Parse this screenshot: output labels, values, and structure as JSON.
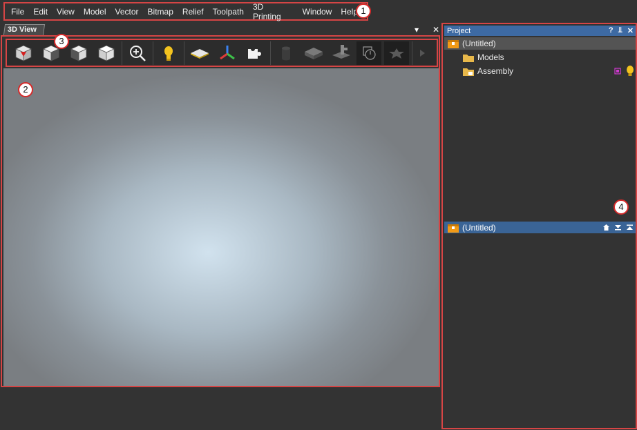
{
  "menu": [
    "File",
    "Edit",
    "View",
    "Model",
    "Vector",
    "Bitmap",
    "Relief",
    "Toolpath",
    "3D Printing",
    "Window",
    "Help"
  ],
  "callouts": [
    "1",
    "2",
    "3",
    "4"
  ],
  "view": {
    "tab_label": "3D View",
    "dropdown_glyph": "▾",
    "close_glyph": "✕"
  },
  "toolbar_icons": [
    "iso-view-cube-icon",
    "front-view-cube-icon",
    "side-view-cube-icon",
    "top-view-cube-icon",
    "zoom-icon",
    "light-bulb-icon",
    "plane-icon",
    "axes-icon",
    "puzzle-icon",
    "cylinder-icon",
    "block-icon",
    "tool-icon",
    "clock-icon",
    "star-icon",
    "more-arrow-icon"
  ],
  "project": {
    "title": "Project",
    "header_controls": [
      "?",
      "⫫",
      "✕"
    ],
    "root": "(Untitled)",
    "children": [
      "Models",
      "Assembly"
    ],
    "lower_root": "(Untitled)",
    "lower_controls": [
      "home-icon",
      "collapse-icon",
      "expand-icon"
    ]
  },
  "colors": {
    "accent_red": "#d64545",
    "selection_blue": "#3d6aa3",
    "folder_yellow": "#e8b84a"
  }
}
